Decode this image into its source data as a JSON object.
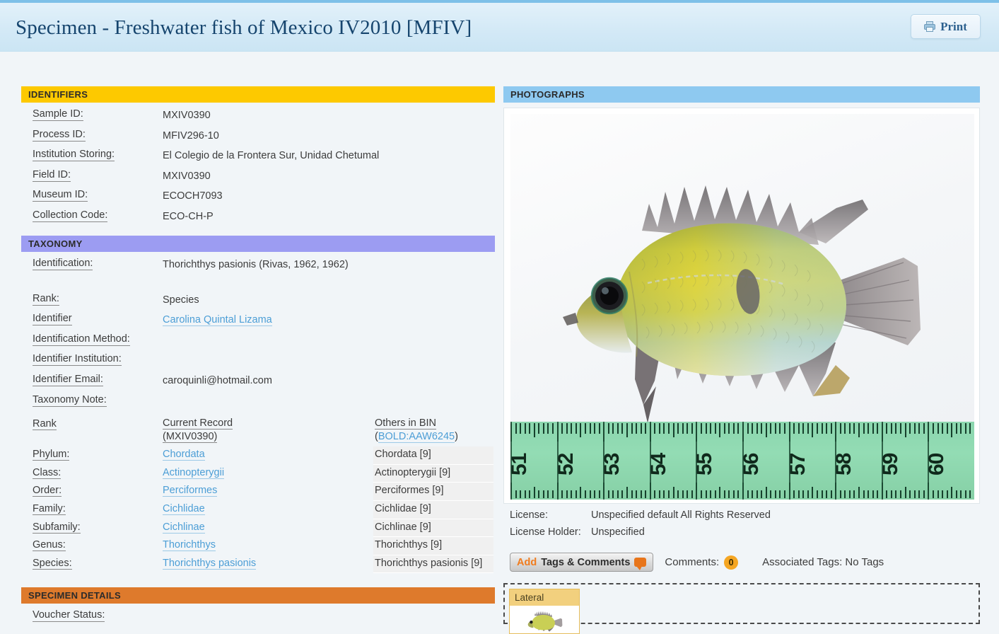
{
  "header": {
    "title": "Specimen - Freshwater fish of Mexico IV2010 [MFIV]",
    "print_label": "Print"
  },
  "identifiers": {
    "section_title": "IDENTIFIERS",
    "rows": [
      {
        "label": "Sample ID:",
        "value": "MXIV0390"
      },
      {
        "label": "Process ID:",
        "value": "MFIV296-10"
      },
      {
        "label": "Institution Storing:",
        "value": "El Colegio de la Frontera Sur, Unidad Chetumal"
      },
      {
        "label": "Field ID:",
        "value": "MXIV0390"
      },
      {
        "label": "Museum ID:",
        "value": "ECOCH7093"
      },
      {
        "label": "Collection Code:",
        "value": "ECO-CH-P"
      }
    ]
  },
  "taxonomy": {
    "section_title": "TAXONOMY",
    "rows": [
      {
        "label": "Identification:",
        "value": "Thorichthys pasionis (Rivas, 1962, 1962)",
        "link": false
      },
      {
        "label": "Rank:",
        "value": "Species",
        "link": false
      },
      {
        "label": "Identifier",
        "value": "Carolina Quintal Lizama",
        "link": true
      },
      {
        "label": "Identification Method:",
        "value": "",
        "link": false
      },
      {
        "label": "Identifier Institution:",
        "value": "",
        "link": false
      },
      {
        "label": "Identifier Email:",
        "value": "caroquinli@hotmail.com",
        "link": false
      },
      {
        "label": "Taxonomy Note:",
        "value": "",
        "link": false
      }
    ],
    "table": {
      "col1_header": "Rank",
      "col2_header_line1": "Current Record",
      "col2_header_line2": "(MXIV0390)",
      "col3_header_line1": "Others in BIN",
      "col3_header_line2_link": "BOLD:AAW6245",
      "ranks": [
        {
          "rank": "Phylum:",
          "current": "Chordata",
          "bin": "Chordata [9]"
        },
        {
          "rank": "Class:",
          "current": "Actinopterygii",
          "bin": "Actinopterygii [9]"
        },
        {
          "rank": "Order:",
          "current": "Perciformes",
          "bin": "Perciformes [9]"
        },
        {
          "rank": "Family:",
          "current": "Cichlidae",
          "bin": "Cichlidae [9]"
        },
        {
          "rank": "Subfamily:",
          "current": "Cichlinae",
          "bin": "Cichlinae [9]"
        },
        {
          "rank": "Genus:",
          "current": "Thorichthys",
          "bin": "Thorichthys [9]"
        },
        {
          "rank": "Species:",
          "current": "Thorichthys pasionis",
          "bin": "Thorichthys pasionis [9]"
        }
      ]
    }
  },
  "specimen_details": {
    "section_title": "SPECIMEN DETAILS",
    "rows": [
      {
        "label": "Voucher Status:",
        "value": ""
      }
    ]
  },
  "photographs": {
    "section_title": "PHOTOGRAPHS",
    "ruler_numbers": [
      "51",
      "52",
      "53",
      "54",
      "55",
      "56",
      "57",
      "58",
      "59",
      "60"
    ],
    "license_label": "License:",
    "license_value": "Unspecified default All Rights Reserved",
    "license_holder_label": "License Holder:",
    "license_holder_value": "Unspecified",
    "tags_button_add": "Add",
    "tags_button_rest": "Tags & Comments",
    "comments_label": "Comments:",
    "comments_count": "0",
    "associated_tags": "Associated Tags: No Tags",
    "thumbnail_label": "Lateral"
  },
  "colors": {
    "identifiers_header": "#fdc900",
    "taxonomy_header": "#9c9cf2",
    "specimen_header": "#de7a2c",
    "photographs_header": "#8ec9f0",
    "link": "#4c9ed6",
    "title": "#16456e",
    "accent_orange": "#f07c1e",
    "badge": "#f5a623",
    "page_bg": "#f1f5f8",
    "ruler_green": "#8bd6ae",
    "thumb_tab": "#f2d07e"
  }
}
